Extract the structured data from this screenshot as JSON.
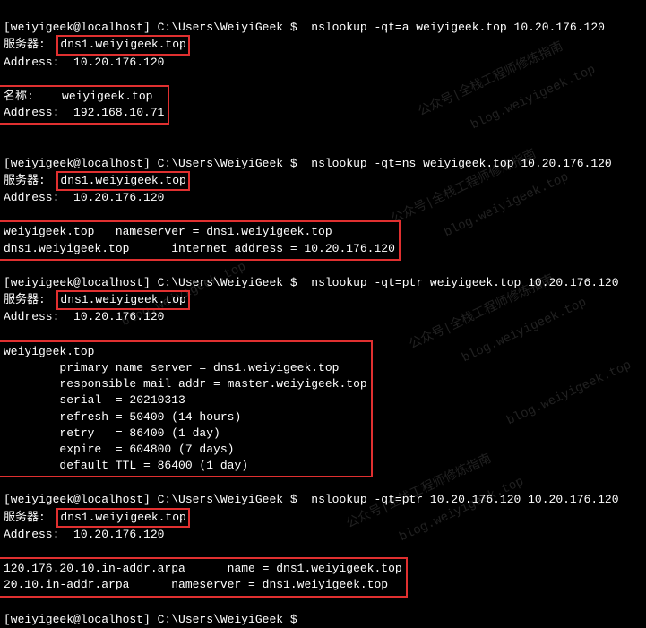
{
  "prompt": "[weiyigeek@localhost] C:\\Users\\WeiyiGeek $ ",
  "cmd1": "nslookup -qt=a weiyigeek.top 10.20.176.120",
  "srv_label": "服务器:  ",
  "srv_name": "dns1.weiyigeek.top",
  "addr_label": "Address:  ",
  "srv_addr": "10.20.176.120",
  "name_label": "名称:    ",
  "name_val": "weiyigeek.top",
  "res1_addr": "192.168.10.71",
  "cmd2": "nslookup -qt=ns weiyigeek.top 10.20.176.120",
  "ns_line1": "weiyigeek.top   nameserver = dns1.weiyigeek.top",
  "ns_line2": "dns1.weiyigeek.top      internet address = 10.20.176.120",
  "cmd3": "nslookup -qt=ptr weiyigeek.top 10.20.176.120",
  "soa_domain": "weiyigeek.top",
  "soa_primary": "        primary name server = dns1.weiyigeek.top",
  "soa_responsible": "        responsible mail addr = master.weiyigeek.top",
  "soa_serial": "        serial  = 20210313",
  "soa_refresh": "        refresh = 50400 (14 hours)",
  "soa_retry": "        retry   = 86400 (1 day)",
  "soa_expire": "        expire  = 604800 (7 days)",
  "soa_ttl": "        default TTL = 86400 (1 day)",
  "cmd4": "nslookup -qt=ptr 10.20.176.120 10.20.176.120",
  "ptr_line1": "120.176.20.10.in-addr.arpa      name = dns1.weiyigeek.top",
  "ptr_line2": "20.10.in-addr.arpa      nameserver = dns1.weiyigeek.top",
  "wm1": "公众号|全栈工程师修炼指南",
  "wm2": "blog.weiyigeek.top"
}
